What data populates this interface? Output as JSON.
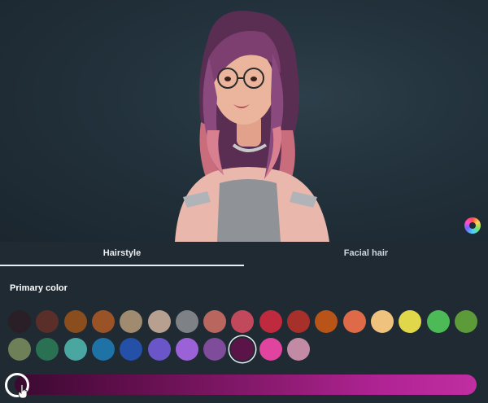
{
  "tabs": {
    "hairstyle": "Hairstyle",
    "facial_hair": "Facial hair"
  },
  "section": {
    "primary_color": "Primary color"
  },
  "swatch_colors": [
    "#2a1f26",
    "#5a2f2a",
    "#8a4d1e",
    "#9a5227",
    "#a08a70",
    "#b8a090",
    "#7e8286",
    "#b8665e",
    "#c2485c",
    "#c02a3e",
    "#a8302a",
    "#b85418",
    "#de6a48",
    "#efc27e",
    "#e0d84a",
    "#4cba56",
    "#5c9a3a",
    "#6e8058",
    "#2a7052",
    "#4aa6a0",
    "#1e72a6",
    "#2450a8",
    "#6a56c8",
    "#9a62d6",
    "#7e4c9a",
    "#5a1448",
    "#e0449e",
    "#c28aa4"
  ],
  "selected_swatch_index": 25,
  "accent": "#e9eef2",
  "icons": {
    "color_wheel": "color-wheel-icon",
    "cursor": "hand-cursor-icon"
  },
  "slider": {
    "value": 0.0
  }
}
